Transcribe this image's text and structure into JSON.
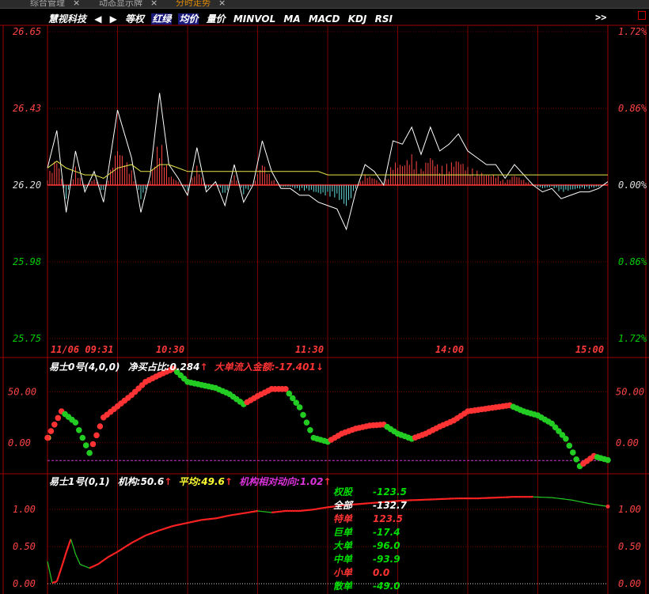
{
  "tabs": [
    {
      "label": "综合管理",
      "close": "×",
      "active": false
    },
    {
      "label": "动态显示牌",
      "close": "×",
      "active": false
    },
    {
      "label": "分时走势",
      "close": "×",
      "active": true
    }
  ],
  "toolbar": {
    "stock_name": "慧视科技",
    "prev_icon": "◀",
    "next_icon": "▶",
    "items": [
      "等权",
      "红绿",
      "均价",
      "量价",
      "MINVOL",
      "MA",
      "MACD",
      "KDJ",
      "RSI"
    ],
    "highlighted": [
      "红绿",
      "均价"
    ],
    "more": ">>",
    "maximize_icon": "window-max-icon"
  },
  "colors": {
    "up": "#ff3333",
    "down": "#00cc00",
    "grid": "#7a0000",
    "price_line": "#ffffff",
    "avg_line": "#e8e84a",
    "tick_text_up": "#ff4444",
    "tick_text_down": "#00cc00",
    "time_text": "#ff3a3a"
  },
  "chart_data": [
    {
      "type": "line",
      "name": "intraday",
      "y_ticks_left": [
        "26.65",
        "26.43",
        "26.20",
        "25.98",
        "25.75"
      ],
      "y_ticks_right": [
        "1.72%",
        "0.86%",
        "0.00%",
        "0.86%",
        "1.72%"
      ],
      "ylim": [
        25.75,
        26.65
      ],
      "x_labels": [
        "11/06 09:31",
        "10:30",
        "11:30",
        "14:00",
        "15:00"
      ],
      "x_ticks": [
        0,
        60,
        120,
        180,
        240
      ],
      "prev_close": 26.2,
      "price_x": [
        0,
        4,
        8,
        12,
        16,
        20,
        24,
        30,
        36,
        40,
        44,
        48,
        52,
        56,
        60,
        64,
        68,
        72,
        76,
        80,
        84,
        88,
        92,
        96,
        100,
        104,
        108,
        112,
        116,
        120,
        124,
        128,
        132,
        136,
        140,
        144,
        148,
        152,
        156,
        160,
        164,
        168,
        172,
        176,
        180,
        184,
        188,
        192,
        196,
        200,
        204,
        208,
        212,
        216,
        220,
        224,
        228,
        232,
        236,
        240
      ],
      "price": [
        26.25,
        26.36,
        26.12,
        26.3,
        26.18,
        26.24,
        26.15,
        26.42,
        26.28,
        26.12,
        26.23,
        26.47,
        26.26,
        26.22,
        26.17,
        26.31,
        26.18,
        26.21,
        26.14,
        26.26,
        26.15,
        26.2,
        26.33,
        26.24,
        26.19,
        26.19,
        26.17,
        26.17,
        26.15,
        26.14,
        26.13,
        26.07,
        26.18,
        26.26,
        26.24,
        26.2,
        26.33,
        26.32,
        26.37,
        26.29,
        26.37,
        26.3,
        26.32,
        26.35,
        26.3,
        26.28,
        26.26,
        26.26,
        26.22,
        26.26,
        26.23,
        26.2,
        26.18,
        26.19,
        26.16,
        26.17,
        26.18,
        26.18,
        26.19,
        26.21
      ],
      "avg": [
        26.25,
        26.27,
        26.25,
        26.24,
        26.23,
        26.23,
        26.22,
        26.25,
        26.26,
        26.24,
        26.24,
        26.26,
        26.26,
        26.25,
        26.24,
        26.24,
        26.24,
        26.24,
        26.24,
        26.24,
        26.24,
        26.24,
        26.24,
        26.24,
        26.24,
        26.24,
        26.24,
        26.24,
        26.24,
        26.23,
        26.23,
        26.23,
        26.23,
        26.23,
        26.23,
        26.23,
        26.23,
        26.23,
        26.23,
        26.23,
        26.23,
        26.23,
        26.23,
        26.23,
        26.23,
        26.23,
        26.23,
        26.23,
        26.23,
        26.23,
        26.23,
        26.23,
        26.23,
        26.23,
        26.23,
        26.23,
        26.23,
        26.23,
        26.23,
        26.23
      ]
    },
    {
      "type": "scatter",
      "name": "易士0号",
      "y_ticks": [
        "50.00",
        "0.00"
      ],
      "ylim": [
        -25,
        70
      ],
      "threshold": -17.4,
      "x": [
        0,
        6,
        12,
        18,
        24,
        30,
        36,
        42,
        48,
        54,
        60,
        66,
        72,
        78,
        84,
        90,
        96,
        102,
        108,
        114,
        120,
        126,
        132,
        138,
        144,
        150,
        156,
        162,
        168,
        174,
        180,
        186,
        192,
        198,
        204,
        210,
        216,
        222,
        228,
        234,
        240
      ],
      "y": [
        5,
        31,
        20,
        -10,
        25,
        36,
        47,
        60,
        67,
        73,
        60,
        57,
        54,
        48,
        38,
        46,
        53,
        53,
        35,
        5,
        1,
        9,
        14,
        17,
        18,
        9,
        4,
        9,
        16,
        22,
        31,
        33,
        35,
        37,
        31,
        27,
        19,
        4,
        -23,
        -13,
        -17
      ]
    },
    {
      "type": "line",
      "name": "易士1号",
      "y_ticks": [
        "1.00",
        "0.50",
        "0.00"
      ],
      "ylim": [
        0,
        1.3
      ],
      "x": [
        0,
        2,
        4,
        6,
        8,
        10,
        12,
        14,
        18,
        22,
        26,
        30,
        36,
        42,
        48,
        54,
        60,
        66,
        72,
        78,
        84,
        90,
        96,
        102,
        108,
        114,
        120,
        128,
        136,
        144,
        152,
        160,
        168,
        176,
        184,
        192,
        200,
        208,
        216,
        224,
        232,
        240
      ],
      "y": [
        0.3,
        0.01,
        0.03,
        0.22,
        0.42,
        0.6,
        0.4,
        0.26,
        0.21,
        0.27,
        0.36,
        0.43,
        0.55,
        0.65,
        0.72,
        0.78,
        0.82,
        0.86,
        0.88,
        0.92,
        0.95,
        0.98,
        0.96,
        0.98,
        0.98,
        1.0,
        1.03,
        1.06,
        1.08,
        1.1,
        1.12,
        1.13,
        1.14,
        1.15,
        1.15,
        1.16,
        1.17,
        1.17,
        1.16,
        1.13,
        1.08,
        1.04
      ]
    }
  ],
  "panel2_info": {
    "name": "易士0号(4,0,0)",
    "net_label": "净买占比:",
    "net_value": "0.284",
    "net_arrow": "↑",
    "inflow_label": "大单流入金额:",
    "inflow_value": "-17.401",
    "inflow_arrow": "↓"
  },
  "panel3_info": {
    "name": "易士1号(0,1)",
    "inst_label": "机构:",
    "inst_value": "50.6",
    "inst_arrow": "↑",
    "avg_label": "平均:",
    "avg_value": "49.6",
    "avg_arrow": "↑",
    "rel_label": "机构相对动向:",
    "rel_value": "1.02",
    "rel_arrow": "↑"
  },
  "breakdown": [
    {
      "label": "权股",
      "value": "-123.5",
      "label_color": "#00dd00",
      "value_color": "#00dd00"
    },
    {
      "label": "全部",
      "value": "-132.7",
      "label_color": "#ffffff",
      "value_color": "#ffffff"
    },
    {
      "label": "特单",
      "value": "123.5",
      "label_color": "#ff3333",
      "value_color": "#ff3333"
    },
    {
      "label": "巨单",
      "value": "-17.4",
      "label_color": "#00dd00",
      "value_color": "#00dd00"
    },
    {
      "label": "大单",
      "value": "-96.0",
      "label_color": "#00dd00",
      "value_color": "#00dd00"
    },
    {
      "label": "中单",
      "value": "-93.9",
      "label_color": "#00dd00",
      "value_color": "#00dd00"
    },
    {
      "label": "小单",
      "value": "0.0",
      "label_color": "#ff3333",
      "value_color": "#ff3333"
    },
    {
      "label": "散单",
      "value": "-49.0",
      "label_color": "#00dd00",
      "value_color": "#00dd00"
    }
  ]
}
